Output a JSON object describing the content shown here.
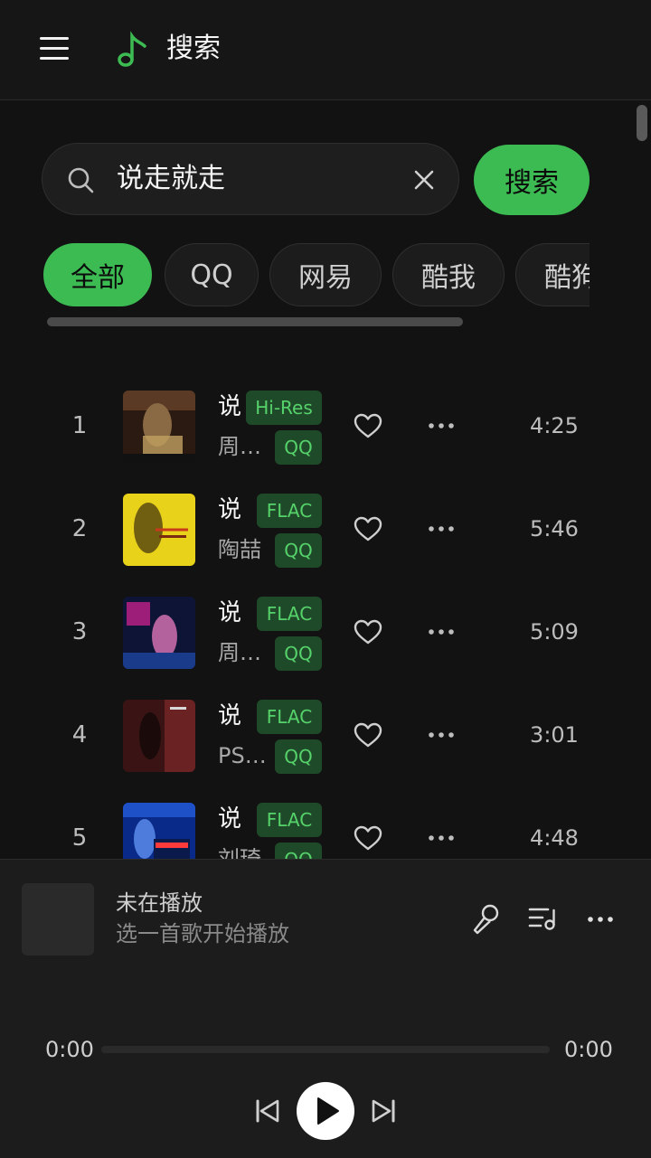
{
  "header": {
    "title": "搜索",
    "menu_icon": "hamburger-menu-icon",
    "logo_icon": "music-note-icon",
    "accent": "#3dbb53"
  },
  "search": {
    "value": "说走就走",
    "button_label": "搜索",
    "search_icon": "search-icon",
    "clear_icon": "close-icon"
  },
  "source_tabs": [
    {
      "label": "全部",
      "active": true
    },
    {
      "label": "QQ",
      "active": false
    },
    {
      "label": "网易",
      "active": false
    },
    {
      "label": "酷我",
      "active": false
    },
    {
      "label": "酷狗",
      "active": false
    }
  ],
  "results": [
    {
      "index": "1",
      "title": "说",
      "artist": "周…",
      "quality": "Hi-Res",
      "source": "QQ",
      "duration": "4:25"
    },
    {
      "index": "2",
      "title": "说",
      "artist": "陶喆",
      "quality": "FLAC",
      "source": "QQ",
      "duration": "5:46"
    },
    {
      "index": "3",
      "title": "说",
      "artist": "周…",
      "quality": "FLAC",
      "source": "QQ",
      "duration": "5:09"
    },
    {
      "index": "4",
      "title": "说",
      "artist": "PS…",
      "quality": "FLAC",
      "source": "QQ",
      "duration": "3:01"
    },
    {
      "index": "5",
      "title": "说",
      "artist": "刘琦",
      "quality": "FLAC",
      "source": "QQ",
      "duration": "4:48"
    }
  ],
  "player": {
    "now_playing_title": "未在播放",
    "now_playing_subtitle": "选一首歌开始播放",
    "current_time": "0:00",
    "total_time": "0:00",
    "progress": 0,
    "icons": [
      "microphone-icon",
      "playlist-icon",
      "more-icon",
      "previous-icon",
      "play-icon",
      "next-icon"
    ]
  }
}
